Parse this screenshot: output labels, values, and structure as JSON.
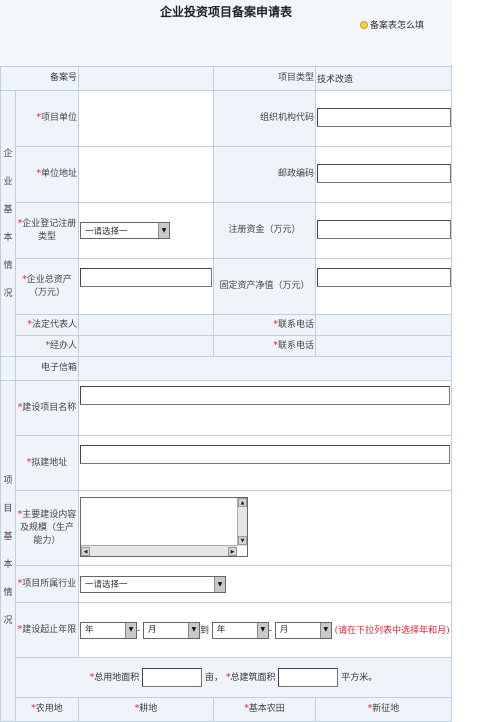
{
  "page": {
    "title": "企业投资项目备案申请表",
    "help_link": "备案表怎么填"
  },
  "form": {
    "record_no_label": "备案号",
    "project_type_label": "项目类型",
    "project_type_value": "技术改造",
    "enterprise_section": "企业基本情况",
    "project_section": "项目基本情况",
    "project_unit_label": "项目单位",
    "org_code_label": "组织机构代码",
    "unit_address_label": "单位地址",
    "postal_code_label": "邮政编码",
    "reg_type_label": "企业登记注册类型",
    "reg_type_value": "一请选择一",
    "reg_capital_label": "注册资金（万元）",
    "total_assets_label": "企业总资产（万元）",
    "fixed_assets_label": "固定资产净值（万元）",
    "legal_rep_label": "法定代表人",
    "contact_phone_label": "联系电话",
    "handler_label": "经办人",
    "contact_phone2_label": "联系电话",
    "email_label": "电子信箱",
    "project_name_label": "建设项目名称",
    "build_address_label": "拟建地址",
    "main_content_label": "主要建设内容及规模（生产能力）",
    "industry_label": "项目所属行业",
    "industry_value": "一请选择一",
    "period_label": "建设起止年限",
    "year_value": "年",
    "month_value": "月",
    "dash": "-",
    "to": "到",
    "period_hint": "(请在下拉列表中选择年和月)",
    "land_area_label": "总用地面积",
    "land_unit": "亩，",
    "building_area_label": "总建筑面积",
    "building_unit": "平方米。",
    "farmland_label": "农用地",
    "arable_label": "耕地",
    "basic_farmland_label": "基本农田",
    "new_land_label": "新征地"
  },
  "colors": {
    "label_bg": "#eef4fa",
    "border": "#bcd0e2",
    "required": "#dd2233"
  }
}
